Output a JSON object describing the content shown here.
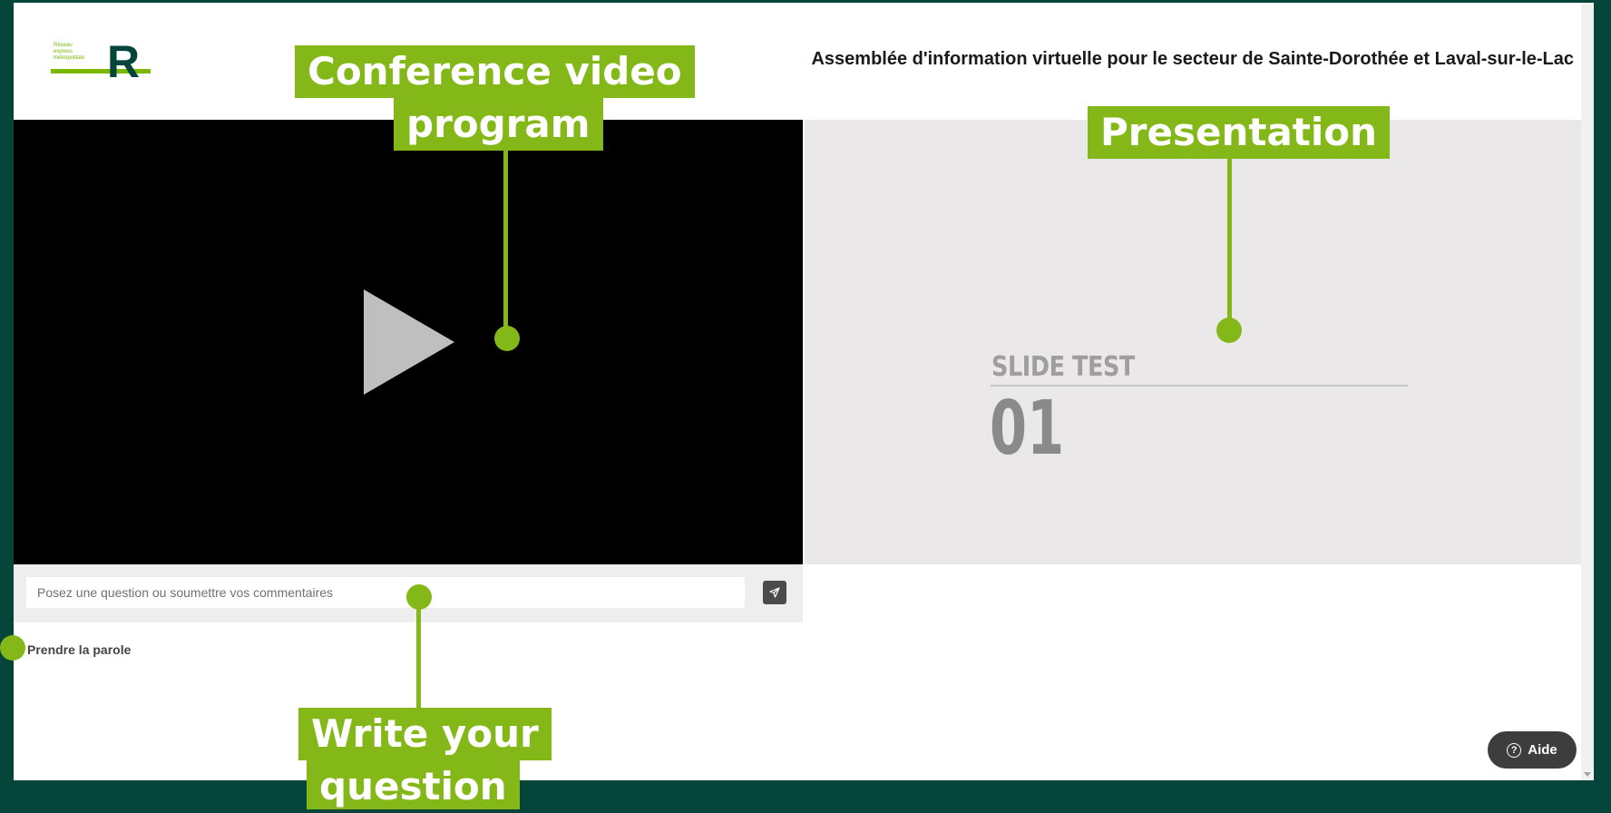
{
  "header": {
    "logo_small_text": "Réseau express métropolitain",
    "logo_letter": "R",
    "title": "Assemblée d'information virtuelle pour le secteur de Sainte-Dorothée et Laval-sur-le-Lac"
  },
  "video": {
    "play_icon": "play-icon"
  },
  "presentation": {
    "slide_title": "SLIDE TEST",
    "slide_number": "01"
  },
  "question": {
    "placeholder": "Posez une question ou soumettre vos commentaires",
    "value": "",
    "send_icon": "send-icon"
  },
  "speak": {
    "label": "Prendre la parole"
  },
  "help": {
    "label": "Aide",
    "icon": "question-circle-icon"
  },
  "annotations": {
    "video_line1": "Conference video",
    "video_line2": "program",
    "presentation": "Presentation",
    "write_line1": "Write your",
    "write_line2": "question"
  },
  "colors": {
    "background": "#064539",
    "accent": "#84b818",
    "video_bg": "#000000",
    "slide_bg": "#eae8e8"
  }
}
